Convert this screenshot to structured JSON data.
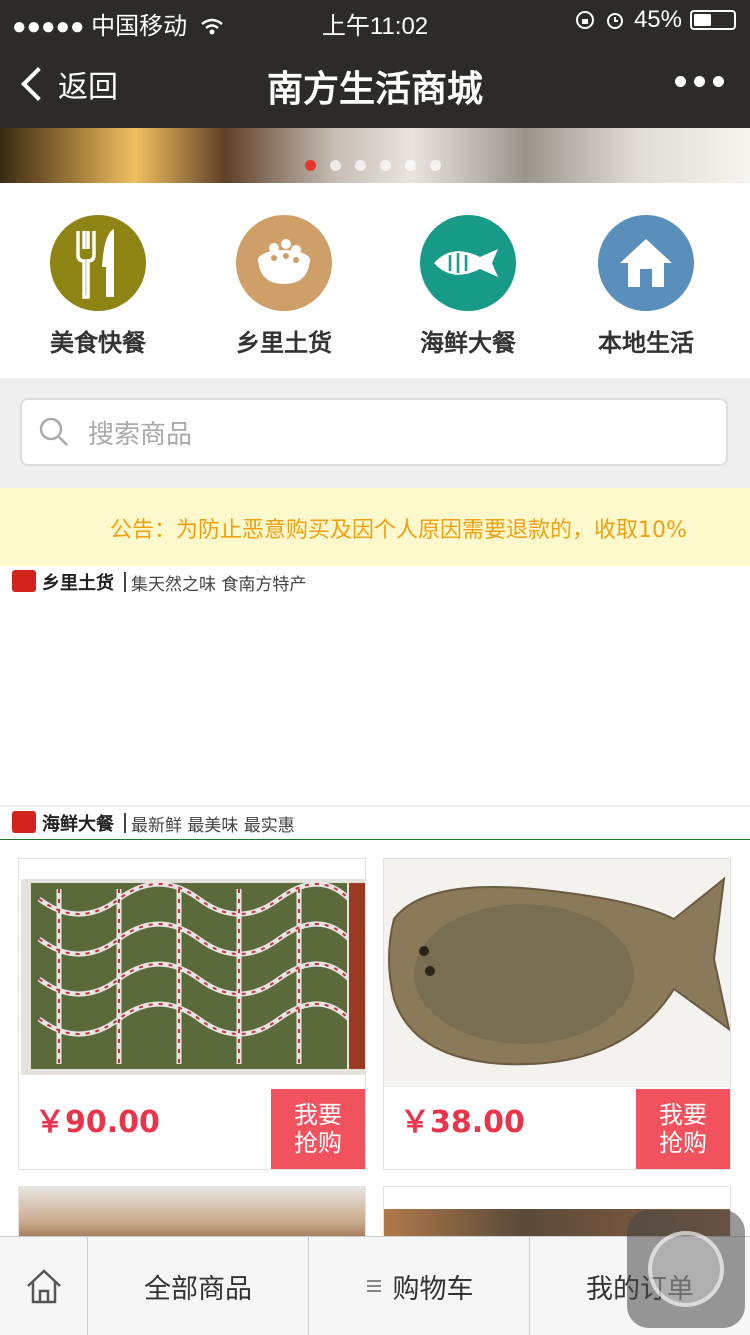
{
  "status_bar": {
    "signal": "●●●●●",
    "carrier": "中国移动",
    "time": "上午11:02",
    "battery": "45%",
    "battery_level": 0.45
  },
  "navbar": {
    "back_label": "返回",
    "title": "南方生活商城"
  },
  "banner": {
    "slide_count": 6,
    "active_slide": 1
  },
  "categories": [
    {
      "label": "美食快餐",
      "icon": "fork-knife-icon",
      "color": "#8e8414"
    },
    {
      "label": "乡里土货",
      "icon": "rice-bowl-icon",
      "color": "#cf9f6a"
    },
    {
      "label": "海鲜大餐",
      "icon": "fish-icon",
      "color": "#179b88"
    },
    {
      "label": "本地生活",
      "icon": "house-icon",
      "color": "#5a8fbc"
    }
  ],
  "search": {
    "placeholder": "搜索商品"
  },
  "notice": {
    "text": "公告：为防止恶意购买及因个人原因需要退款的，收取10%"
  },
  "sections": [
    {
      "name": "乡里土货",
      "slogan": "集天然之味  食南方特产"
    },
    {
      "name": "海鲜大餐",
      "slogan": "最新鲜  最美味  最实惠"
    }
  ],
  "products": [
    {
      "price": "￥90.00",
      "buy_label": "我要\n抢购",
      "image": "tied-crabs-image"
    },
    {
      "price": "￥38.00",
      "buy_label": "我要\n抢购",
      "image": "flatfish-image"
    }
  ],
  "tabbar": {
    "all_products": "全部商品",
    "cart": "购物车",
    "orders": "我的订单"
  },
  "colors": {
    "nav_bg": "#2e2a27",
    "price": "#e8354c",
    "buy_button": "#f2515e",
    "notice_text": "#f0a010",
    "notice_bg": "#fef9cc",
    "section_line": "#1e7a2a"
  }
}
